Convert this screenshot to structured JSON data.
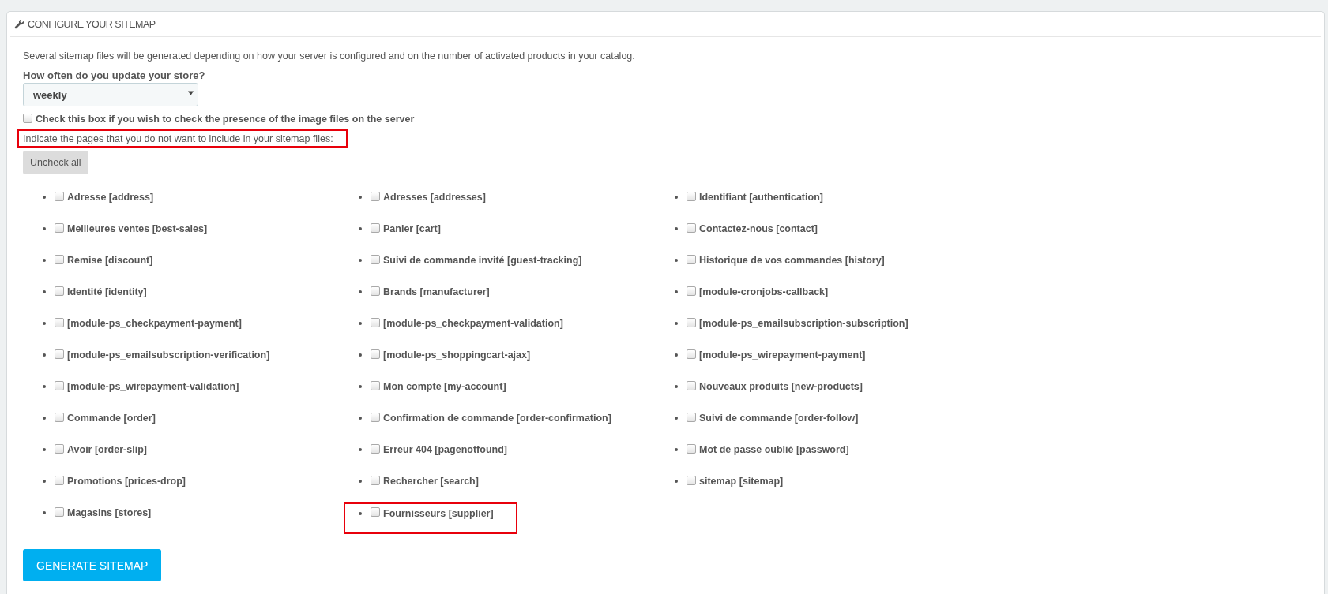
{
  "panel": {
    "title": "CONFIGURE YOUR SITEMAP"
  },
  "description": "Several sitemap files will be generated depending on how your server is configured and on the number of activated products in your catalog.",
  "frequency": {
    "label": "How often do you update your store?",
    "value": "weekly"
  },
  "image_check": {
    "label": "Check this box if you wish to check the presence of the image files on the server",
    "checked": false
  },
  "instruction": {
    "text": "Indicate the pages that you do not want to include in your sitemap files:",
    "highlighted": true
  },
  "uncheck_all_button": "Uncheck all",
  "pages": [
    {
      "label": "Adresse [address]",
      "checked": false,
      "highlighted": false
    },
    {
      "label": "Adresses [addresses]",
      "checked": false,
      "highlighted": false
    },
    {
      "label": "Identifiant [authentication]",
      "checked": false,
      "highlighted": false
    },
    {
      "label": "Meilleures ventes [best-sales]",
      "checked": false,
      "highlighted": false
    },
    {
      "label": "Panier [cart]",
      "checked": false,
      "highlighted": false
    },
    {
      "label": "Contactez-nous [contact]",
      "checked": false,
      "highlighted": false
    },
    {
      "label": "Remise [discount]",
      "checked": false,
      "highlighted": false
    },
    {
      "label": "Suivi de commande invité [guest-tracking]",
      "checked": false,
      "highlighted": false
    },
    {
      "label": "Historique de vos commandes [history]",
      "checked": false,
      "highlighted": false
    },
    {
      "label": "Identité [identity]",
      "checked": false,
      "highlighted": false
    },
    {
      "label": "Brands [manufacturer]",
      "checked": false,
      "highlighted": false
    },
    {
      "label": "[module-cronjobs-callback]",
      "checked": false,
      "highlighted": false
    },
    {
      "label": "[module-ps_checkpayment-payment]",
      "checked": false,
      "highlighted": false
    },
    {
      "label": "[module-ps_checkpayment-validation]",
      "checked": false,
      "highlighted": false
    },
    {
      "label": "[module-ps_emailsubscription-subscription]",
      "checked": false,
      "highlighted": false
    },
    {
      "label": "[module-ps_emailsubscription-verification]",
      "checked": false,
      "highlighted": false
    },
    {
      "label": "[module-ps_shoppingcart-ajax]",
      "checked": false,
      "highlighted": false
    },
    {
      "label": "[module-ps_wirepayment-payment]",
      "checked": false,
      "highlighted": false
    },
    {
      "label": "[module-ps_wirepayment-validation]",
      "checked": false,
      "highlighted": false
    },
    {
      "label": "Mon compte [my-account]",
      "checked": false,
      "highlighted": false
    },
    {
      "label": "Nouveaux produits [new-products]",
      "checked": false,
      "highlighted": false
    },
    {
      "label": "Commande [order]",
      "checked": false,
      "highlighted": false
    },
    {
      "label": "Confirmation de commande [order-confirmation]",
      "checked": false,
      "highlighted": false
    },
    {
      "label": "Suivi de commande [order-follow]",
      "checked": false,
      "highlighted": false
    },
    {
      "label": "Avoir [order-slip]",
      "checked": false,
      "highlighted": false
    },
    {
      "label": "Erreur 404 [pagenotfound]",
      "checked": false,
      "highlighted": false
    },
    {
      "label": "Mot de passe oublié [password]",
      "checked": false,
      "highlighted": false
    },
    {
      "label": "Promotions [prices-drop]",
      "checked": false,
      "highlighted": false
    },
    {
      "label": "Rechercher [search]",
      "checked": false,
      "highlighted": false
    },
    {
      "label": "sitemap [sitemap]",
      "checked": false,
      "highlighted": false
    },
    {
      "label": "Magasins [stores]",
      "checked": false,
      "highlighted": false
    },
    {
      "label": "Fournisseurs [supplier]",
      "checked": false,
      "highlighted": true
    }
  ],
  "generate_button": "GENERATE SITEMAP"
}
